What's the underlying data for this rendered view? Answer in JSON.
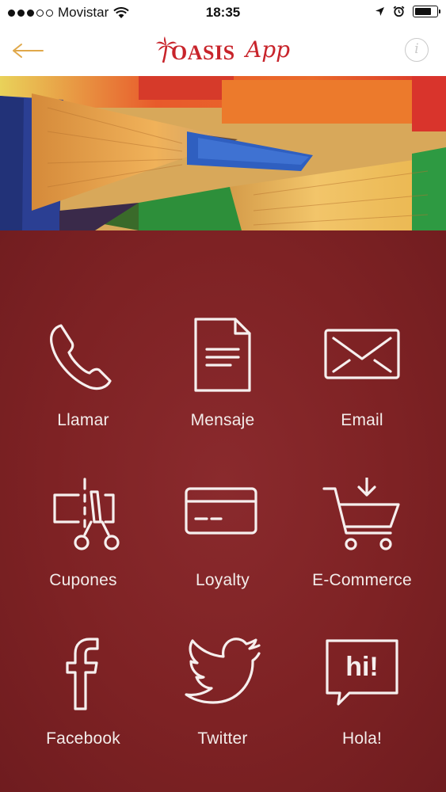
{
  "status_bar": {
    "carrier": "Movistar",
    "time": "18:35",
    "signal_dots_filled": 3,
    "signal_dots_total": 5,
    "battery_level_fraction": 0.75
  },
  "nav": {
    "logo_main": "OASIS",
    "logo_sub": "App",
    "back_icon": "arrow-left-icon",
    "info_icon": "info-icon",
    "info_glyph": "i",
    "accent_color": "#c8242b",
    "back_color": "#e0a84a"
  },
  "main": {
    "background_color": "#7e2224",
    "tiles": [
      {
        "label": "Llamar",
        "icon": "phone-icon"
      },
      {
        "label": "Mensaje",
        "icon": "document-icon"
      },
      {
        "label": "Email",
        "icon": "envelope-icon"
      },
      {
        "label": "Cupones",
        "icon": "coupon-scissors-icon"
      },
      {
        "label": "Loyalty",
        "icon": "credit-card-icon"
      },
      {
        "label": "E-Commerce",
        "icon": "shopping-cart-icon"
      },
      {
        "label": "Facebook",
        "icon": "facebook-icon"
      },
      {
        "label": "Twitter",
        "icon": "twitter-bird-icon"
      },
      {
        "label": "Hola!",
        "icon": "speech-bubble-icon",
        "icon_text": "hi!"
      }
    ]
  }
}
